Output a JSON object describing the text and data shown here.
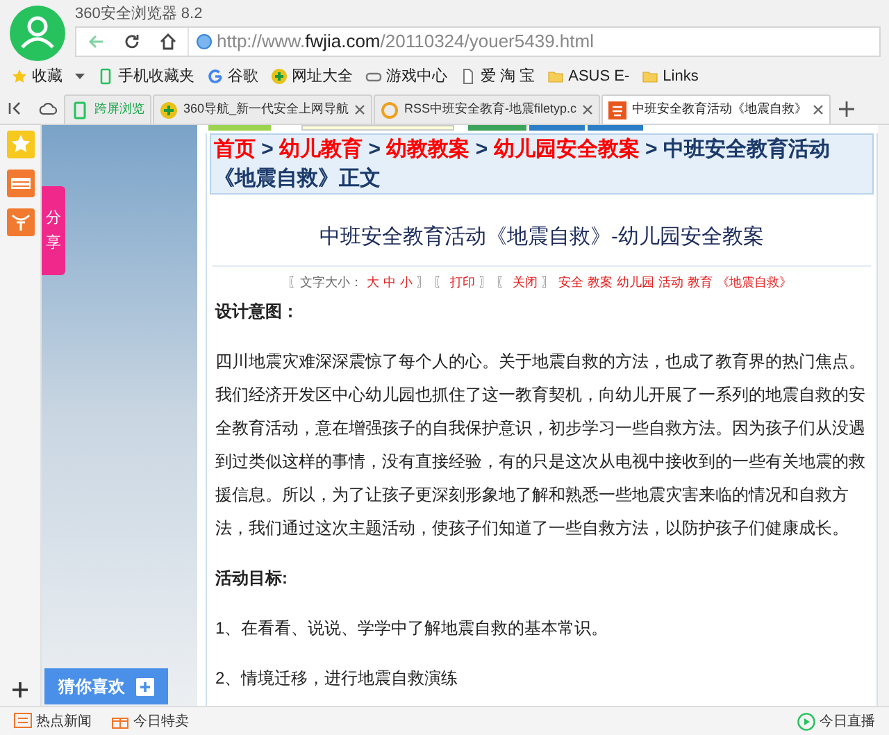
{
  "window": {
    "title": "360安全浏览器 8.2"
  },
  "address": {
    "scheme": "http://www.",
    "domain": "fwjia.com",
    "path": "/20110324/youer5439.html"
  },
  "bookmarks": [
    {
      "label": "收藏",
      "kind": "star"
    },
    {
      "label": "手机收藏夹",
      "kind": "phone"
    },
    {
      "label": "谷歌",
      "kind": "g"
    },
    {
      "label": "网址大全",
      "kind": "plus"
    },
    {
      "label": "游戏中心",
      "kind": "game"
    },
    {
      "label": "爱 淘 宝",
      "kind": "page"
    },
    {
      "label": "ASUS E-",
      "kind": "folder"
    },
    {
      "label": "Links",
      "kind": "folder"
    }
  ],
  "tabs": [
    {
      "label": "跨屏浏览",
      "kind": "cross",
      "selected": false
    },
    {
      "label": "360导航_新一代安全上网导航",
      "kind": "nav",
      "selected": false
    },
    {
      "label": "RSS中班安全教育-地震filetyp.c",
      "kind": "rss",
      "selected": false
    },
    {
      "label": "中班安全教育活动《地震自救》",
      "kind": "site",
      "selected": true
    }
  ],
  "sidebar": {
    "share": "分享",
    "recommend": "猜你喜欢"
  },
  "breadcrumb": {
    "links": [
      "首页",
      "幼儿教育",
      "幼教教案",
      "幼儿园安全教案"
    ],
    "separator": ">",
    "current": "中班安全教育活动《地震自救》正文"
  },
  "article": {
    "title": "中班安全教育活动《地震自救》-幼儿园安全教案",
    "tools": [
      {
        "text": "〖文字大小：",
        "kind": "plain"
      },
      {
        "text": "大",
        "kind": "link"
      },
      {
        "text": "中",
        "kind": "link"
      },
      {
        "text": "小",
        "kind": "link"
      },
      {
        "text": "〗",
        "kind": "plain"
      },
      {
        "text": "〖",
        "kind": "plain"
      },
      {
        "text": "打印",
        "kind": "link"
      },
      {
        "text": "〗",
        "kind": "plain"
      },
      {
        "text": "〖",
        "kind": "plain"
      },
      {
        "text": "关闭",
        "kind": "link"
      },
      {
        "text": "〗",
        "kind": "plain"
      },
      {
        "text": "安全",
        "kind": "link"
      },
      {
        "text": "教案",
        "kind": "link"
      },
      {
        "text": "幼儿园",
        "kind": "link"
      },
      {
        "text": "活动",
        "kind": "link"
      },
      {
        "text": "教育",
        "kind": "link"
      },
      {
        "text": "《地震自救》",
        "kind": "link"
      }
    ],
    "blocks": [
      {
        "kind": "heading",
        "text": "设计意图："
      },
      {
        "kind": "para",
        "text": "四川地震灾难深深震惊了每个人的心。关于地震自救的方法，也成了教育界的热门焦点。我们经济开发区中心幼儿园也抓住了这一教育契机，向幼儿开展了一系列的地震自救的安全教育活动，意在增强孩子的自我保护意识，初步学习一些自救方法。因为孩子们从没遇到过类似这样的事情，没有直接经验，有的只是这次从电视中接收到的一些有关地震的救援信息。所以，为了让孩子更深刻形象地了解和熟悉一些地震灾害来临的情况和自救方法，我们通过这次主题活动，使孩子们知道了一些自救方法，以防护孩子们健康成长。"
      },
      {
        "kind": "heading",
        "text": "活动目标:"
      },
      {
        "kind": "para",
        "text": "1、在看看、说说、学学中了解地震自救的基本常识。"
      },
      {
        "kind": "para",
        "text": "2、情境迁移，进行地震自救演练"
      }
    ]
  },
  "status_bar": {
    "left": [
      "热点新闻",
      "今日特卖"
    ],
    "right": "今日直播"
  }
}
